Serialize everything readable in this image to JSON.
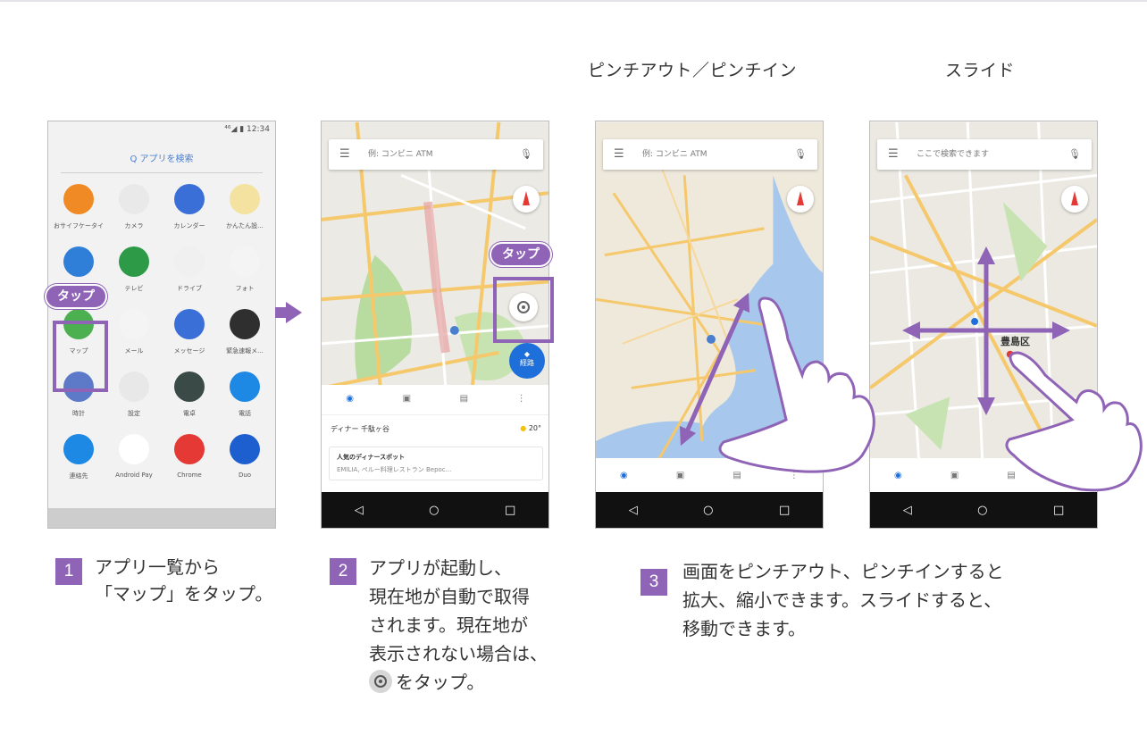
{
  "captions": {
    "pinch": "ピンチアウト／ピンチイン",
    "slide": "スライド"
  },
  "phone1": {
    "status": "⁴⁶◢ ▮ 12:34",
    "search": "Q アプリを検索",
    "apps": [
      {
        "label": "おサイフケータイ",
        "color": "#f08a25"
      },
      {
        "label": "カメラ",
        "color": "#e9e9e9"
      },
      {
        "label": "カレンダー",
        "color": "#3b6fd8"
      },
      {
        "label": "かんたん設...",
        "color": "#f3e2a0"
      },
      {
        "label": "",
        "color": "#2f7fd8"
      },
      {
        "label": "テレビ",
        "color": "#2d9a48"
      },
      {
        "label": "ドライブ",
        "color": "#f0f0f0"
      },
      {
        "label": "フォト",
        "color": "#f4f4f4"
      },
      {
        "label": "マップ",
        "color": "#4caf50"
      },
      {
        "label": "メール",
        "color": "#f4f4f4"
      },
      {
        "label": "メッセージ",
        "color": "#3b6fd8"
      },
      {
        "label": "緊急速報メ...",
        "color": "#2f2f2f"
      },
      {
        "label": "時計",
        "color": "#5d7ac9"
      },
      {
        "label": "設定",
        "color": "#e8e8e8"
      },
      {
        "label": "電卓",
        "color": "#3a4a46"
      },
      {
        "label": "電話",
        "color": "#1e88e5"
      },
      {
        "label": "連絡先",
        "color": "#1e88e5"
      },
      {
        "label": "Android Pay",
        "color": "#ffffff"
      },
      {
        "label": "Chrome",
        "color": "#e53935"
      },
      {
        "label": "Duo",
        "color": "#1e5fd0"
      }
    ],
    "tag": "タップ"
  },
  "phone2": {
    "search": "例: コンビニ ATM",
    "tag": "タップ",
    "route": "経路",
    "weather": "ディナー 千駄ヶ谷",
    "temp": "20°",
    "card_title": "人気のディナースポット",
    "card_sub": "EMILIA, ペルー料理レストラン Bepoc..."
  },
  "phone3": {
    "search": "例: コンビニ ATM"
  },
  "phone4": {
    "search": "ここで検索できます",
    "place": "豊島区"
  },
  "steps": [
    {
      "num": "1",
      "lines": [
        "アプリ一覧から",
        "「マップ」をタップ。"
      ]
    },
    {
      "num": "2",
      "lines": [
        "アプリが起動し、",
        "現在地が自動で取得",
        "されます。現在地が",
        "表示されない場合は、",
        "をタップ。"
      ]
    },
    {
      "num": "3",
      "lines": [
        "画面をピンチアウト、ピンチインすると",
        "拡大、縮小できます。スライドすると、",
        "移動できます。"
      ]
    }
  ],
  "colors": {
    "accent": "#8f64b6"
  }
}
